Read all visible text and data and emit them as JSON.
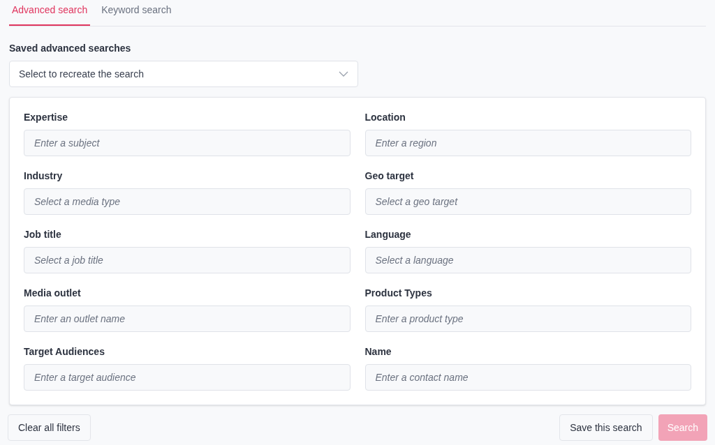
{
  "tabs": [
    {
      "label": "Advanced search",
      "selected": true
    },
    {
      "label": "Keyword search",
      "selected": false
    }
  ],
  "saved_searches": {
    "label": "Saved advanced searches",
    "placeholder": "Select to recreate the search"
  },
  "fields": [
    {
      "label": "Expertise",
      "placeholder": "Enter a subject"
    },
    {
      "label": "Location",
      "placeholder": "Enter a region"
    },
    {
      "label": "Industry",
      "placeholder": "Select a media type"
    },
    {
      "label": "Geo target",
      "placeholder": "Select a geo target"
    },
    {
      "label": "Job title",
      "placeholder": "Select a job title"
    },
    {
      "label": "Language",
      "placeholder": "Select a language"
    },
    {
      "label": "Media outlet",
      "placeholder": "Enter an outlet name"
    },
    {
      "label": "Product Types",
      "placeholder": "Enter a product type"
    },
    {
      "label": "Target Audiences",
      "placeholder": "Enter a target audience"
    },
    {
      "label": "Name",
      "placeholder": "Enter a contact name"
    }
  ],
  "buttons": {
    "clear": "Clear all filters",
    "save": "Save this search",
    "search": {
      "label": "Search",
      "disabled": true
    }
  }
}
